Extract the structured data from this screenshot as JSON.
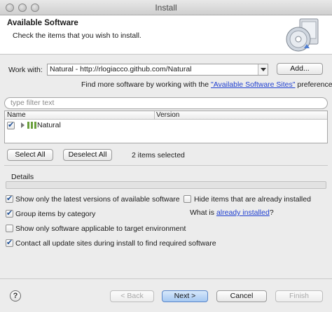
{
  "window": {
    "title": "Install"
  },
  "banner": {
    "title": "Available Software",
    "description": "Check the items that you wish to install.",
    "icon": "software-install-cd-icon"
  },
  "work_with": {
    "label": "Work with:",
    "value": "Natural - http://rlogiacco.github.com/Natural",
    "add_button": "Add..."
  },
  "sites_hint": {
    "prefix": "Find more software by working with the ",
    "link": "\"Available Software Sites\"",
    "suffix": " preferences."
  },
  "filter": {
    "placeholder": "type filter text"
  },
  "table": {
    "columns": [
      "Name",
      "Version"
    ],
    "rows": [
      {
        "name": "Natural",
        "version": "",
        "checked": true,
        "icon": "category-icon"
      }
    ]
  },
  "selection": {
    "select_all": "Select All",
    "deselect_all": "Deselect All",
    "status": "2 items selected"
  },
  "details": {
    "label": "Details"
  },
  "options": {
    "latest_versions": {
      "label": "Show only the latest versions of available software",
      "checked": true
    },
    "hide_installed": {
      "label": "Hide items that are already installed",
      "checked": false
    },
    "group_by_category": {
      "label": "Group items by category",
      "checked": true
    },
    "already_installed": {
      "prefix": "What is ",
      "link": "already installed",
      "suffix": "?"
    },
    "target_env": {
      "label": "Show only software applicable to target environment",
      "checked": false
    },
    "contact_sites": {
      "label": "Contact all update sites during install to find required software",
      "checked": true
    }
  },
  "footer": {
    "help": "?",
    "back": "< Back",
    "next": "Next >",
    "cancel": "Cancel",
    "finish": "Finish"
  }
}
